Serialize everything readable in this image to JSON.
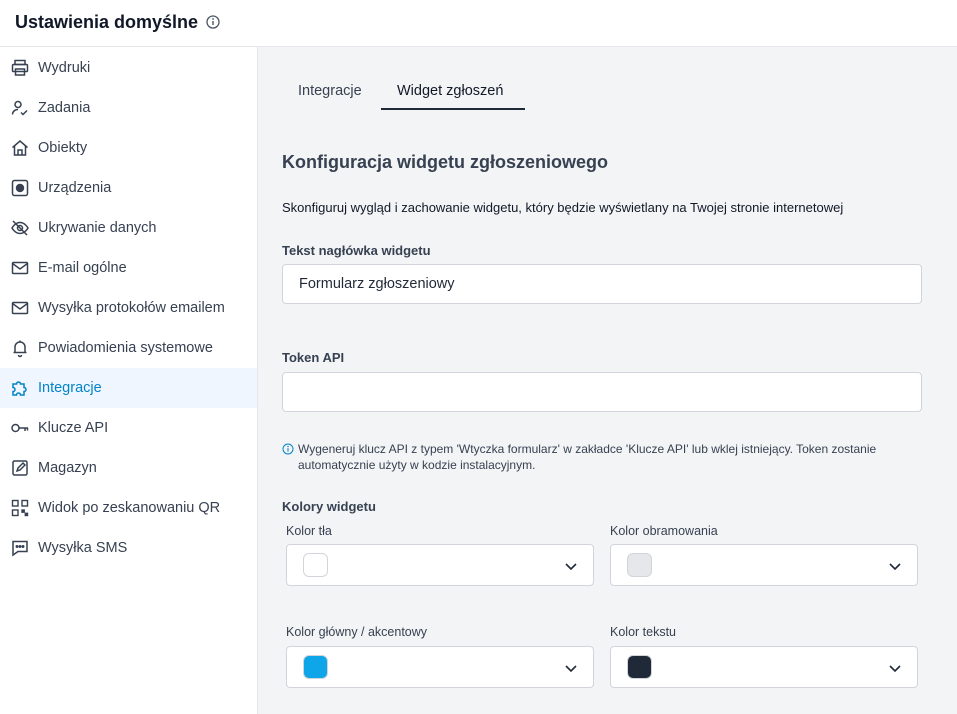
{
  "header": {
    "title": "Ustawienia domyślne"
  },
  "sidebar": {
    "items": [
      {
        "label": "Wydruki"
      },
      {
        "label": "Zadania"
      },
      {
        "label": "Obiekty"
      },
      {
        "label": "Urządzenia"
      },
      {
        "label": "Ukrywanie danych"
      },
      {
        "label": "E-mail ogólne"
      },
      {
        "label": "Wysyłka protokołów emailem"
      },
      {
        "label": "Powiadomienia systemowe"
      },
      {
        "label": "Integracje"
      },
      {
        "label": "Klucze API"
      },
      {
        "label": "Magazyn"
      },
      {
        "label": "Widok po zeskanowaniu QR"
      },
      {
        "label": "Wysyłka SMS"
      }
    ],
    "active_index": 8
  },
  "tabs": [
    {
      "label": "Integracje"
    },
    {
      "label": "Widget zgłoszeń",
      "active": true
    }
  ],
  "section": {
    "title": "Konfiguracja widgetu zgłoszeniowego",
    "description": "Skonfiguruj wygląd i zachowanie widgetu, który będzie wyświetlany na Twojej stronie internetowej"
  },
  "header_text_field": {
    "label": "Tekst nagłówka widgetu",
    "value": "Formularz zgłoszeniowy"
  },
  "token_field": {
    "label": "Token API",
    "value": ""
  },
  "token_hint": "Wygeneruj klucz API z typem 'Wtyczka formularz' w zakładce 'Klucze API' lub wklej istniejący. Token zostanie automatycznie użyty w kodzie instalacyjnym.",
  "colors": {
    "title": "Kolory widgetu",
    "background": {
      "label": "Kolor tła",
      "value": "#ffffff"
    },
    "border": {
      "label": "Kolor obramowania",
      "value": "#e5e7eb"
    },
    "accent": {
      "label": "Kolor główny / akcentowy",
      "value": "#0ea5e9"
    },
    "text": {
      "label": "Kolor tekstu",
      "value": "#1f2937"
    }
  }
}
